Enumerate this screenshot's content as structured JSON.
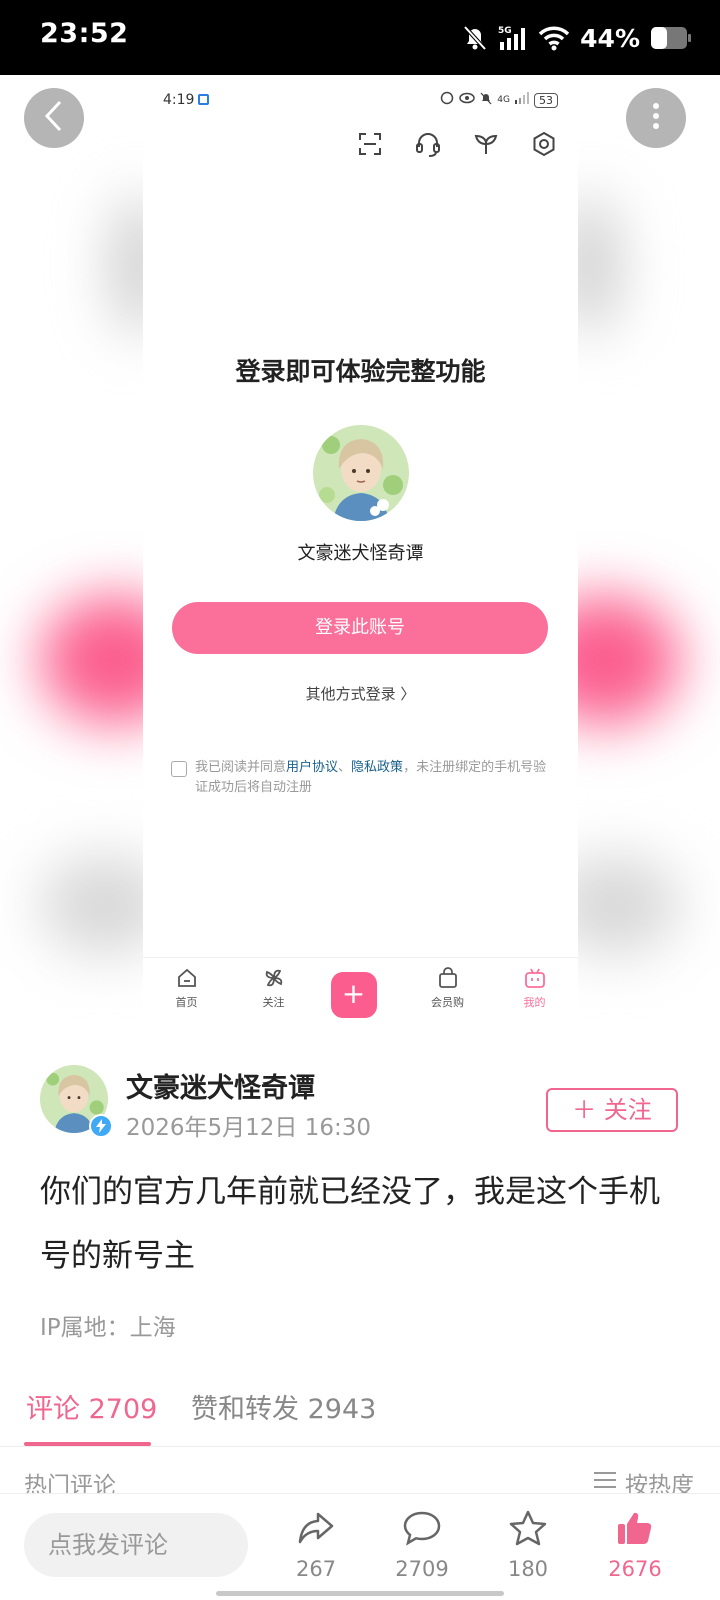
{
  "status_bar": {
    "time": "23:52",
    "battery": "44%",
    "network": "5G"
  },
  "inner_screenshot": {
    "status_time": "4:19",
    "status_network": "4G",
    "status_battery": "53",
    "login_title": "登录即可体验完整功能",
    "account_name": "文豪迷犬怪奇谭",
    "login_button": "登录此账号",
    "other_login": "其他方式登录 〉",
    "agreement": {
      "prefix": "我已阅读并同意",
      "user_agreement": "用户协议",
      "separator": "、",
      "privacy_policy": "隐私政策",
      "suffix": "，未注册绑定的手机号验证成功后将自动注册"
    },
    "nav": {
      "home": "首页",
      "follow": "关注",
      "plus": "+",
      "member_shop": "会员购",
      "mine": "我的"
    }
  },
  "post": {
    "author": "文豪迷犬怪奇谭",
    "time": "2026年5月12日 16:30",
    "follow_button": "＋ 关注",
    "content": "你们的官方几年前就已经没了，我是这个手机号的新号主",
    "ip_location": "IP属地：上海"
  },
  "tabs": {
    "comments": "评论 2709",
    "likes_reposts": "赞和转发 2943"
  },
  "comments_header": {
    "hot": "热门评论",
    "sort": "按热度"
  },
  "bottom_bar": {
    "input_placeholder": "点我发评论",
    "share_count": "267",
    "comment_count": "2709",
    "favorite_count": "180",
    "like_count": "2676"
  },
  "colors": {
    "accent": "#f1668f",
    "login_button": "#fb6f9b"
  }
}
